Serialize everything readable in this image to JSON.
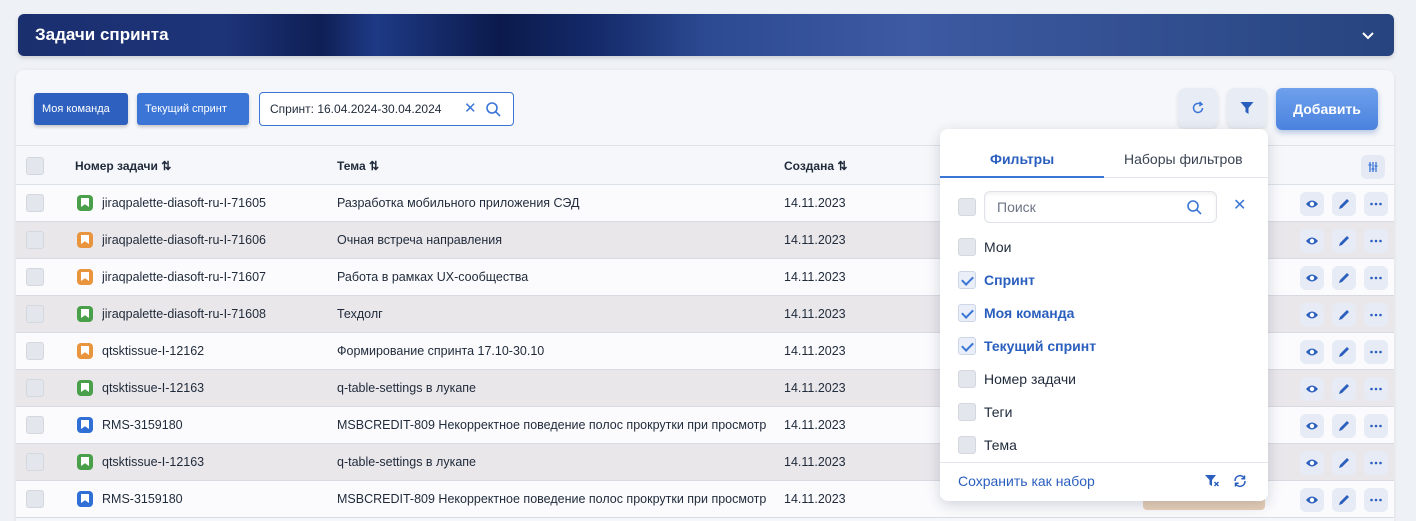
{
  "header": {
    "title": "Задачи спринта"
  },
  "toolbar": {
    "chips": [
      "Моя команда",
      "Текущий спринт"
    ],
    "sprint_filter": "Спринт: 16.04.2024-30.04.2024",
    "add_label": "Добавить"
  },
  "table": {
    "columns": [
      "Номер задачи",
      "Тема",
      "Создана"
    ],
    "rows": [
      {
        "id": "jiraqpalette-diasoft-ru-I-71605",
        "subject": "Разработка мобильного приложения СЭД",
        "created": "14.11.2023",
        "type_color": "#4aa04a"
      },
      {
        "id": "jiraqpalette-diasoft-ru-I-71606",
        "subject": "Очная встреча направления",
        "created": "14.11.2023",
        "type_color": "#e8953e"
      },
      {
        "id": "jiraqpalette-diasoft-ru-I-71607",
        "subject": "Работа в рамках UX-сообщества",
        "created": "14.11.2023",
        "type_color": "#e8953e"
      },
      {
        "id": "jiraqpalette-diasoft-ru-I-71608",
        "subject": "Техдолг",
        "created": "14.11.2023",
        "type_color": "#4aa04a"
      },
      {
        "id": "qtsktissue-I-12162",
        "subject": "Формирование спринта 17.10-30.10",
        "created": "14.11.2023",
        "type_color": "#e8953e"
      },
      {
        "id": "qtsktissue-I-12163",
        "subject": "q-table-settings в лукапе",
        "created": "14.11.2023",
        "type_color": "#4aa04a"
      },
      {
        "id": "RMS-3159180",
        "subject": "MSBCREDIT-809 Некорректное поведение полос прокрутки при просмотр",
        "created": "14.11.2023",
        "type_color": "#2f6fd6"
      },
      {
        "id": "qtsktissue-I-12163",
        "subject": "q-table-settings в лукапе",
        "created": "14.11.2023",
        "type_color": "#4aa04a"
      },
      {
        "id": "RMS-3159180",
        "subject": "MSBCREDIT-809 Некорректное поведение полос прокрутки при просмотр",
        "created": "14.11.2023",
        "type_color": "#2f6fd6"
      }
    ]
  },
  "filter_popup": {
    "tabs": [
      "Фильтры",
      "Наборы фильтров"
    ],
    "search_placeholder": "Поиск",
    "items": [
      {
        "label": "Мои",
        "checked": false
      },
      {
        "label": "Спринт",
        "checked": true
      },
      {
        "label": "Моя команда",
        "checked": true
      },
      {
        "label": "Текущий спринт",
        "checked": true
      },
      {
        "label": "Номер задачи",
        "checked": false
      },
      {
        "label": "Теги",
        "checked": false
      },
      {
        "label": "Тема",
        "checked": false
      }
    ],
    "save_label": "Сохранить как набор"
  },
  "colors": {
    "accent": "#3b76d6",
    "header": "#1d3479",
    "green": "#4aa04a",
    "orange": "#e8953e",
    "blue": "#2f6fd6"
  }
}
